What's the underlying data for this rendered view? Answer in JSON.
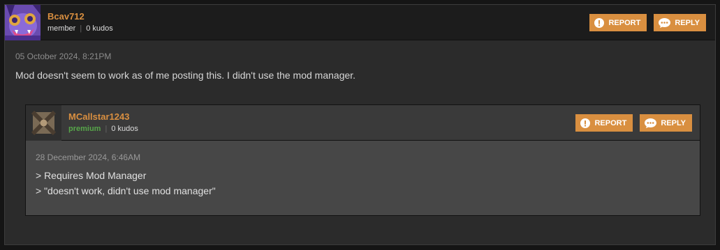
{
  "comment": {
    "username": "Bcav712",
    "role": "member",
    "kudos": "0 kudos",
    "date": "05 October 2024, 8:21PM",
    "text": "Mod doesn't seem to work as of me posting this. I didn't use the mod manager.",
    "report_label": "REPORT",
    "reply_label": "REPLY"
  },
  "reply": {
    "username": "MCallstar1243",
    "role": "premium",
    "kudos": "0 kudos",
    "date": "28 December 2024, 6:46AM",
    "lines": [
      "> Requires Mod Manager",
      "> \"doesn't work, didn't use mod manager\""
    ],
    "report_label": "REPORT",
    "reply_label": "REPLY"
  },
  "colors": {
    "accent": "#d98f40",
    "premium": "#57a64a",
    "background": "#2b2b2b"
  },
  "icons": {
    "report": "alert-circle-icon",
    "reply": "speech-bubble-icon"
  }
}
